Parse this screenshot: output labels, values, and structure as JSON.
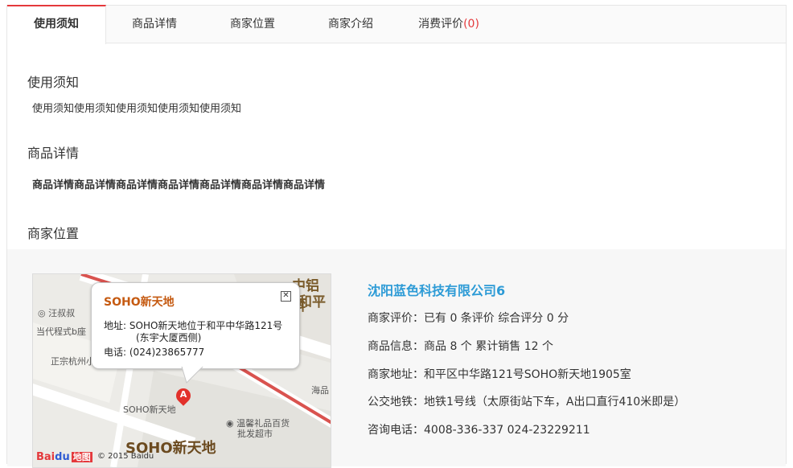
{
  "tabs": [
    {
      "label": "使用须知"
    },
    {
      "label": "商品详情"
    },
    {
      "label": "商家位置"
    },
    {
      "label": "商家介绍"
    },
    {
      "label": "消费评价",
      "count": "(0)"
    }
  ],
  "sections": {
    "notice": {
      "title": "使用须知",
      "text": "使用须知使用须知使用须知使用须知使用须知"
    },
    "detail": {
      "title": "商品详情",
      "text": "商品详情商品详情商品详情商品详情商品详情商品详情商品详情"
    },
    "location": {
      "title": "商家位置"
    }
  },
  "map": {
    "popup": {
      "title": "SOHO新天地",
      "address_label": "地址:",
      "address_line1": "SOHO新天地位于和平中华路121号",
      "address_line2": "(东宇大厦西侧)",
      "phone_label": "电话:",
      "phone": "(024)23865777"
    },
    "marker_label": "A",
    "labels": {
      "wangshushu": "汪叔叔",
      "dangdai": "当代程式b座",
      "zhengzong": "正宗杭州小",
      "soho_small": "SOHO新天地",
      "soho_big": "SOHO新天地",
      "zhonglv": "中铝科",
      "heping": "和平",
      "haipin": "海品",
      "wenxin1": "温馨礼品百货",
      "wenxin2": "批发超市",
      "copyright": "© 2015 Baidu"
    },
    "logo": {
      "bai": "Bai",
      "du": "du",
      "ditu": "地图"
    }
  },
  "merchant": {
    "name": "沈阳蓝色科技有限公司6",
    "rating": "商家评价：已有 0 条评价 综合评分 0 分",
    "goods": "商品信息：商品 8 个 累计销售 12 个",
    "address": "商家地址：和平区中华路121号SOHO新天地1905室",
    "transit": "公交地铁：地铁1号线（太原街站下车，A出口直行410米即是）",
    "phone": "咨询电话：4008-336-337 024-23229211"
  },
  "colors": {
    "accent": "#e4393c",
    "link": "#2d9bd6",
    "popup_title": "#c55a11"
  }
}
